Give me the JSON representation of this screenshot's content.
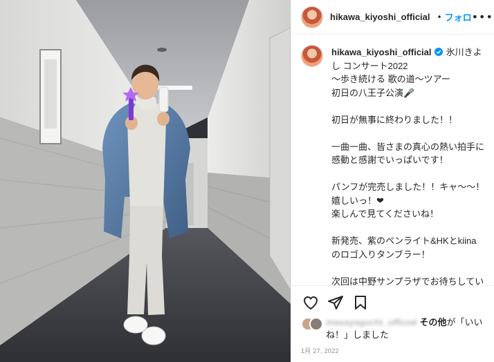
{
  "photo": {
    "description_icon": "post-photo"
  },
  "header": {
    "username": "hikawa_kiyoshi_official",
    "separator": "•",
    "follow_label": "フォロ",
    "more_label": "•••"
  },
  "caption": {
    "username": "hikawa_kiyoshi_official",
    "text": "氷川きよし コンサート2022\n〜歩き続ける 歌の道〜ツアー\n初日の八王子公演🎤\n\n初日が無事に終わりました！！\n\n一曲一曲、皆さまの真心の熱い拍手に感動と感謝でいっぱいです！\n\nパンフが完売しました！！キャ〜〜！嬉しいっ！❤\n楽しんで見てくださいね！\n\n新発売、紫のペンライト&HKとkiinaのロゴ入りタンブラー！\n\n次回は中野サンプラザでお待ちしています！\n\n肩下まで伸びた髪はピターッとして真ん中で分けて結えるスタイル"
  },
  "likes": {
    "blurred_name": "masayaguchi_official",
    "others_label": "その他",
    "suffix": "が「いいね！」しました"
  },
  "date": "1月 27, 2022",
  "colors": {
    "accent": "#0095f6",
    "text": "#262626",
    "muted": "#8e8e8e",
    "border": "#efefef"
  },
  "icons": [
    "verified-badge-icon",
    "heart-icon",
    "share-icon",
    "bookmark-icon",
    "more-icon"
  ]
}
